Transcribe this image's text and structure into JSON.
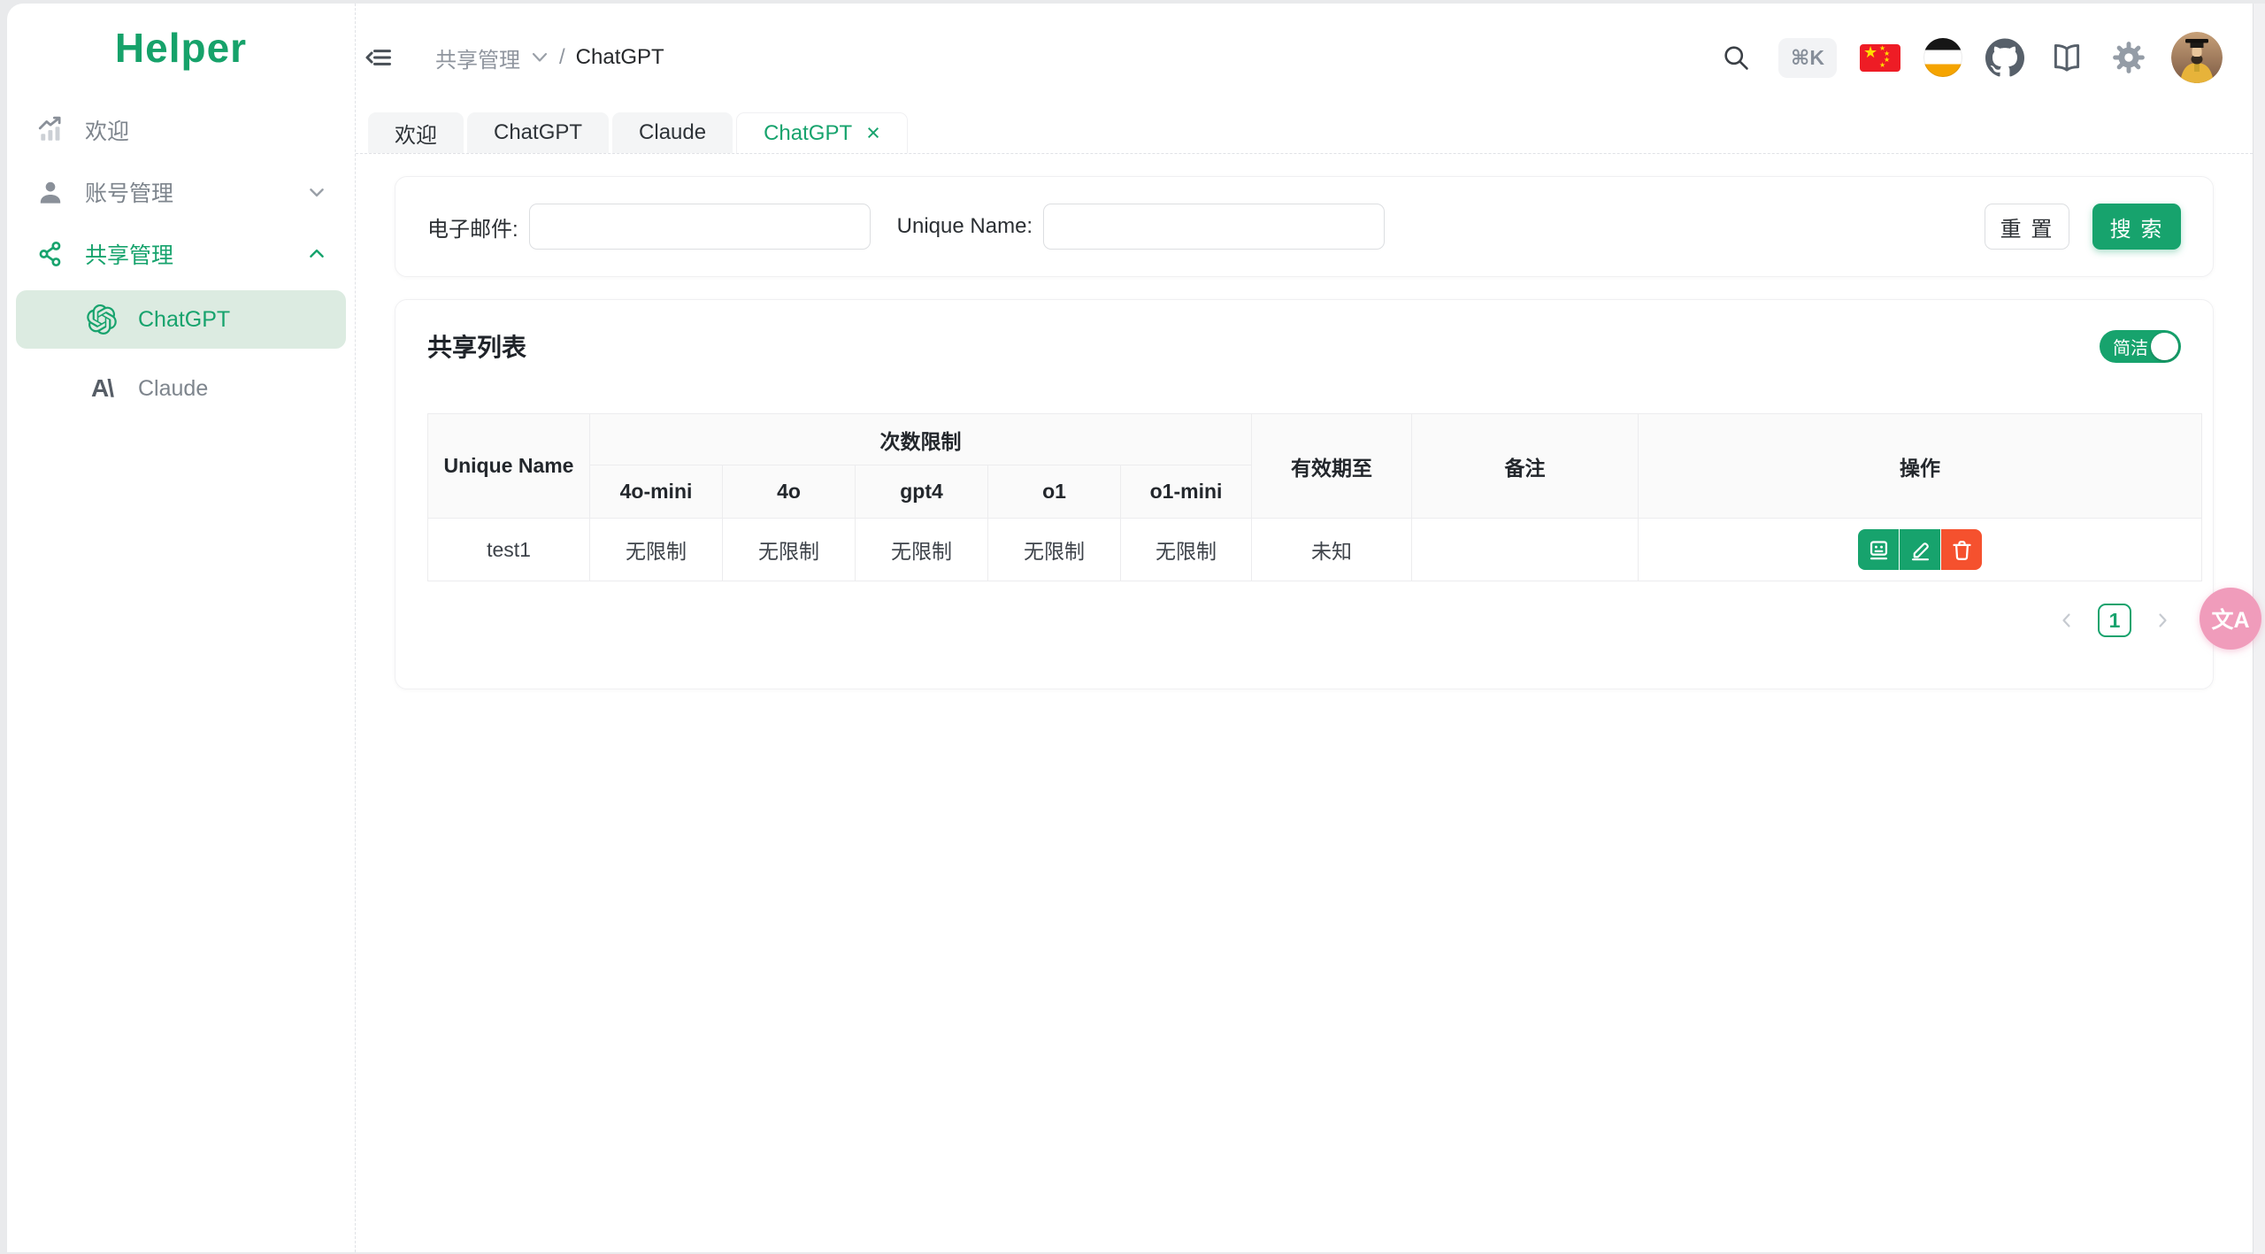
{
  "app": {
    "brand": "Helper"
  },
  "colors": {
    "primary_green": "#17a36d",
    "selected_item_bg": "#dcebe1",
    "danger_red": "#f5512e",
    "flag_red": "#ee1c25",
    "flag_yellow": "#ffde00",
    "translate_pink": "#f09cbb",
    "header_icon_gray": "#57606a"
  },
  "sidebar": {
    "items": [
      {
        "label": "欢迎",
        "icon": "trend-chart-icon"
      },
      {
        "label": "账号管理",
        "icon": "user-icon",
        "chevron": "down"
      },
      {
        "label": "共享管理",
        "icon": "share-nodes-icon",
        "chevron": "up"
      },
      {
        "label": "ChatGPT",
        "icon": "openai-icon"
      },
      {
        "label": "Claude",
        "icon": "anthropic-icon",
        "mark": "A\\"
      }
    ]
  },
  "header": {
    "breadcrumb": {
      "parent": "共享管理",
      "separator": "/",
      "current": "ChatGPT"
    },
    "shortcut": "⌘K"
  },
  "tabs": [
    {
      "label": "欢迎"
    },
    {
      "label": "ChatGPT"
    },
    {
      "label": "Claude"
    },
    {
      "label": "ChatGPT",
      "close": "×"
    }
  ],
  "search_form": {
    "email_label": "电子邮件:",
    "email_value": "",
    "unique_name_label": "Unique Name:",
    "unique_name_value": "",
    "reset_label": "重 置",
    "search_label": "搜 索"
  },
  "share_list": {
    "title": "共享列表",
    "toggle_label": "简洁",
    "table": {
      "headers": {
        "unique_name": "Unique Name",
        "limits_group": "次数限制",
        "models": [
          "4o-mini",
          "4o",
          "gpt4",
          "o1",
          "o1-mini"
        ],
        "valid_until": "有效期至",
        "remark": "备注",
        "actions": "操作"
      },
      "rows": [
        {
          "unique_name": "test1",
          "limits": [
            "无限制",
            "无限制",
            "无限制",
            "无限制",
            "无限制"
          ],
          "valid_until": "未知",
          "remark": ""
        }
      ]
    },
    "pagination": {
      "current_page": "1"
    }
  },
  "floating": {
    "translate_label": "文A"
  }
}
